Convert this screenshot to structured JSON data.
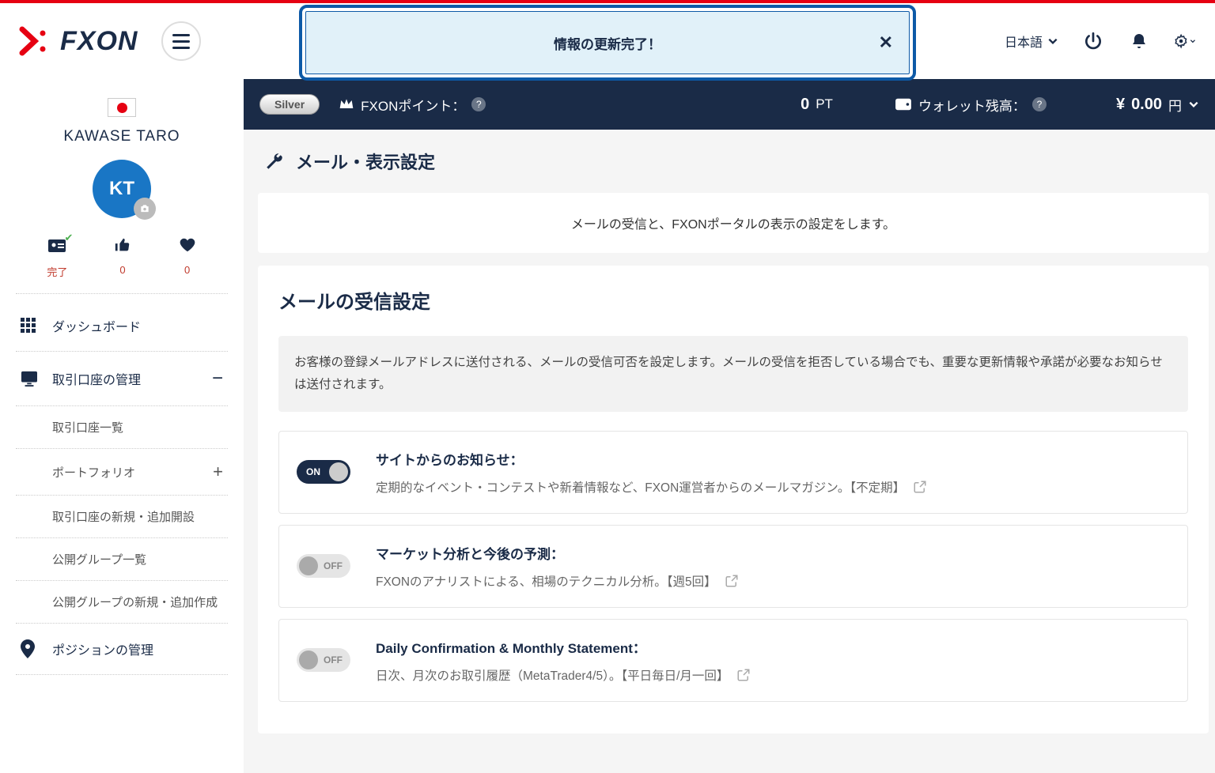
{
  "brand": "FXON",
  "banner": {
    "text": "情報の更新完了！"
  },
  "header": {
    "lang": "日本語"
  },
  "profile": {
    "name": "KAWASE TARO",
    "initials": "KT",
    "stats": {
      "verify": "完了",
      "likes": "0",
      "hearts": "0"
    }
  },
  "nav": {
    "dashboard": "ダッシュボード",
    "accounts": "取引口座の管理",
    "sub1": "取引口座一覧",
    "sub2": "ポートフォリオ",
    "sub3": "取引口座の新規・追加開設",
    "sub4": "公開グループ一覧",
    "sub5": "公開グループの新規・追加作成",
    "positions": "ポジションの管理"
  },
  "topbar": {
    "tier": "Silver",
    "points_label": "FXONポイント：",
    "points_value": "0",
    "points_unit": "PT",
    "wallet_label": "ウォレット残高：",
    "currency": "¥",
    "balance": "0.00",
    "balance_unit": "円"
  },
  "page": {
    "title": "メール・表示設定",
    "intro": "メールの受信と、FXONポータルの表示の設定をします。",
    "section_title": "メールの受信設定",
    "info": "お客様の登録メールアドレスに送付される、メールの受信可否を設定します。メールの受信を拒否している場合でも、重要な更新情報や承諾が必要なお知らせは送付されます。"
  },
  "settings": [
    {
      "title": "サイトからのお知らせ：",
      "desc": "定期的なイベント・コンテストや新着情報など、FXON運営者からのメールマガジン。【不定期】",
      "on": true,
      "on_label": "ON"
    },
    {
      "title": "マーケット分析と今後の予測：",
      "desc": "FXONのアナリストによる、相場のテクニカル分析。【週5回】",
      "on": false,
      "on_label": "OFF"
    },
    {
      "title": "Daily Confirmation & Monthly Statement：",
      "desc": "日次、月次のお取引履歴（MetaTrader4/5）。【平日毎日/月一回】",
      "on": false,
      "on_label": "OFF"
    }
  ]
}
